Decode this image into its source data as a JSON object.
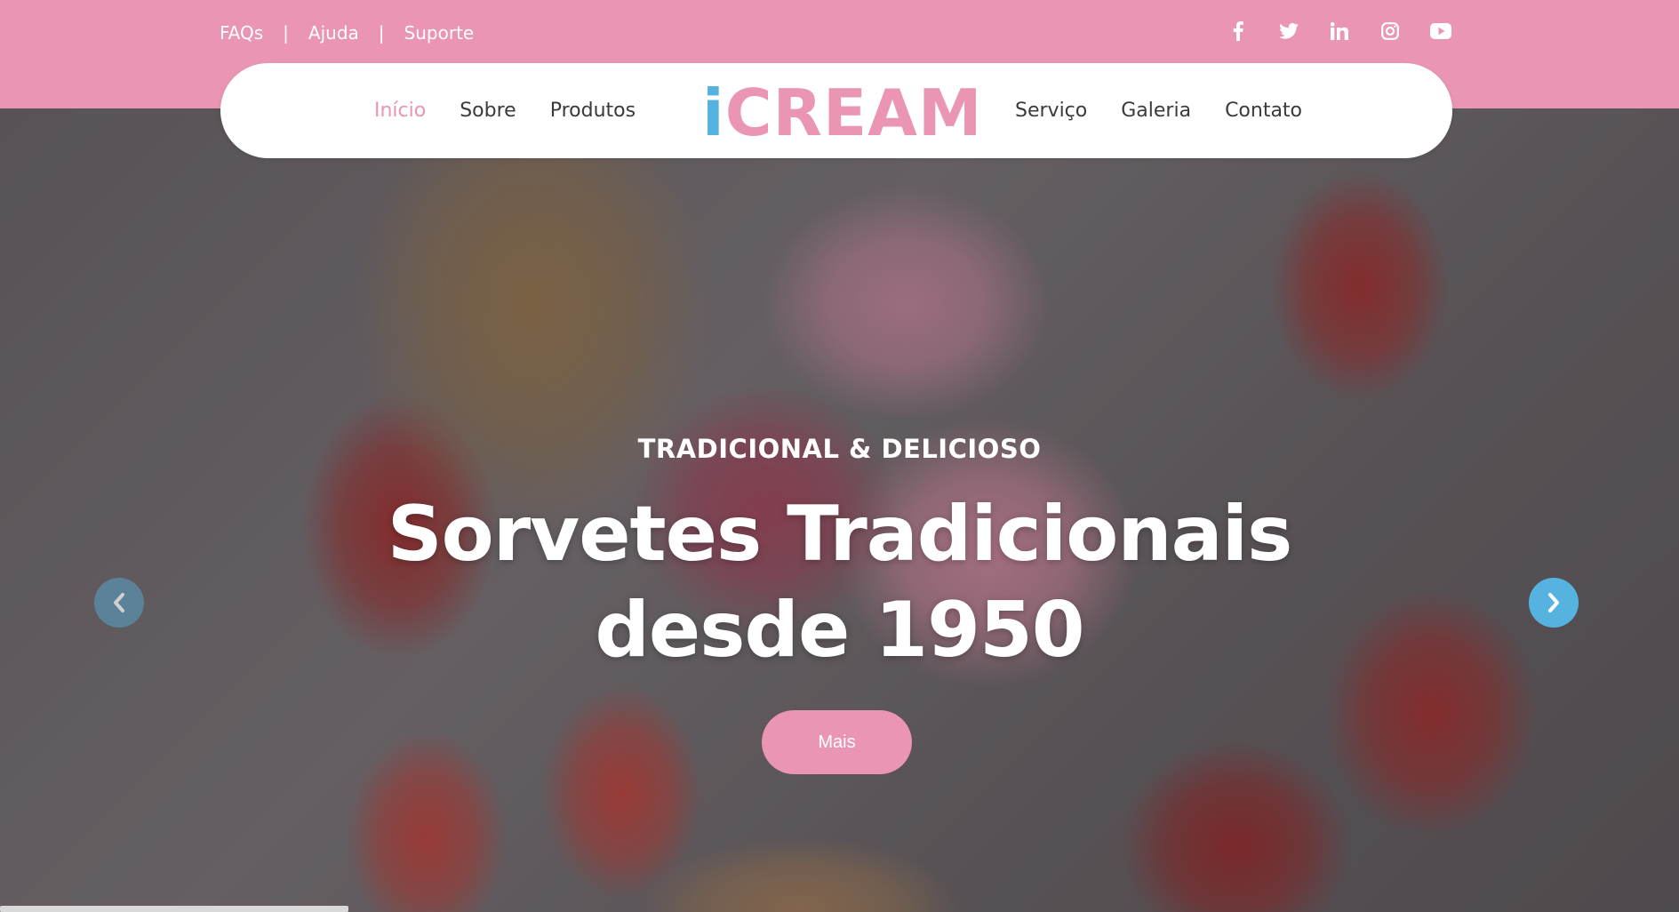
{
  "topbar": {
    "links": [
      {
        "label": "FAQs"
      },
      {
        "label": "Ajuda"
      },
      {
        "label": "Suporte"
      }
    ],
    "separator": "|",
    "social": [
      "facebook-icon",
      "twitter-icon",
      "linkedin-icon",
      "instagram-icon",
      "youtube-icon"
    ]
  },
  "nav": {
    "left": [
      {
        "label": "Início",
        "active": true
      },
      {
        "label": "Sobre"
      },
      {
        "label": "Produtos"
      }
    ],
    "right": [
      {
        "label": "Serviço"
      },
      {
        "label": "Galeria"
      },
      {
        "label": "Contato"
      }
    ],
    "logo": {
      "first": "i",
      "rest": "CREAM"
    }
  },
  "hero": {
    "subtitle": "TRADICIONAL & DELICIOSO",
    "headline_line1": "Sorvetes Tradicionais",
    "headline_line2": "desde 1950",
    "button": "Mais"
  },
  "colors": {
    "brand_pink": "#e995b3",
    "brand_blue": "#56b3e0"
  }
}
